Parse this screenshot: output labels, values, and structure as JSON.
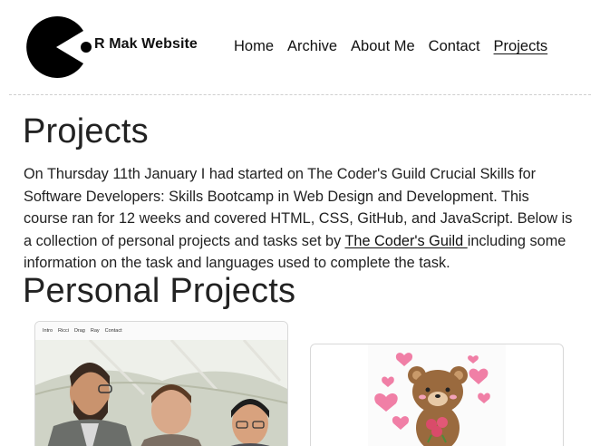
{
  "header": {
    "site_title": "R Mak Website",
    "nav": [
      {
        "label": "Home"
      },
      {
        "label": "Archive"
      },
      {
        "label": "About Me"
      },
      {
        "label": "Contact"
      },
      {
        "label": "Projects",
        "active": true
      }
    ]
  },
  "main": {
    "title": "Projects",
    "intro_text": "On Thursday 11th January I had started on The Coder's Guild Crucial Skills for Software Developers: Skills Bootcamp in Web Design and Development. This course ran for 12 weeks and covered HTML, CSS, GitHub, and JavaScript. Below is a collection of personal projects and tasks set by ",
    "intro_link": "The Coder's Guild ",
    "intro_tail": "including some information on the task and languages used to complete the task.",
    "section_title": "Personal Projects",
    "cards": [
      {
        "mini_nav": [
          "Intro",
          "Ricci",
          "Drag",
          "Ray",
          "Contact"
        ]
      },
      {}
    ]
  },
  "colors": {
    "text": "#222222",
    "border": "#d8d8d8",
    "heart": "#f07fa6",
    "bear": "#9a6a3e"
  }
}
